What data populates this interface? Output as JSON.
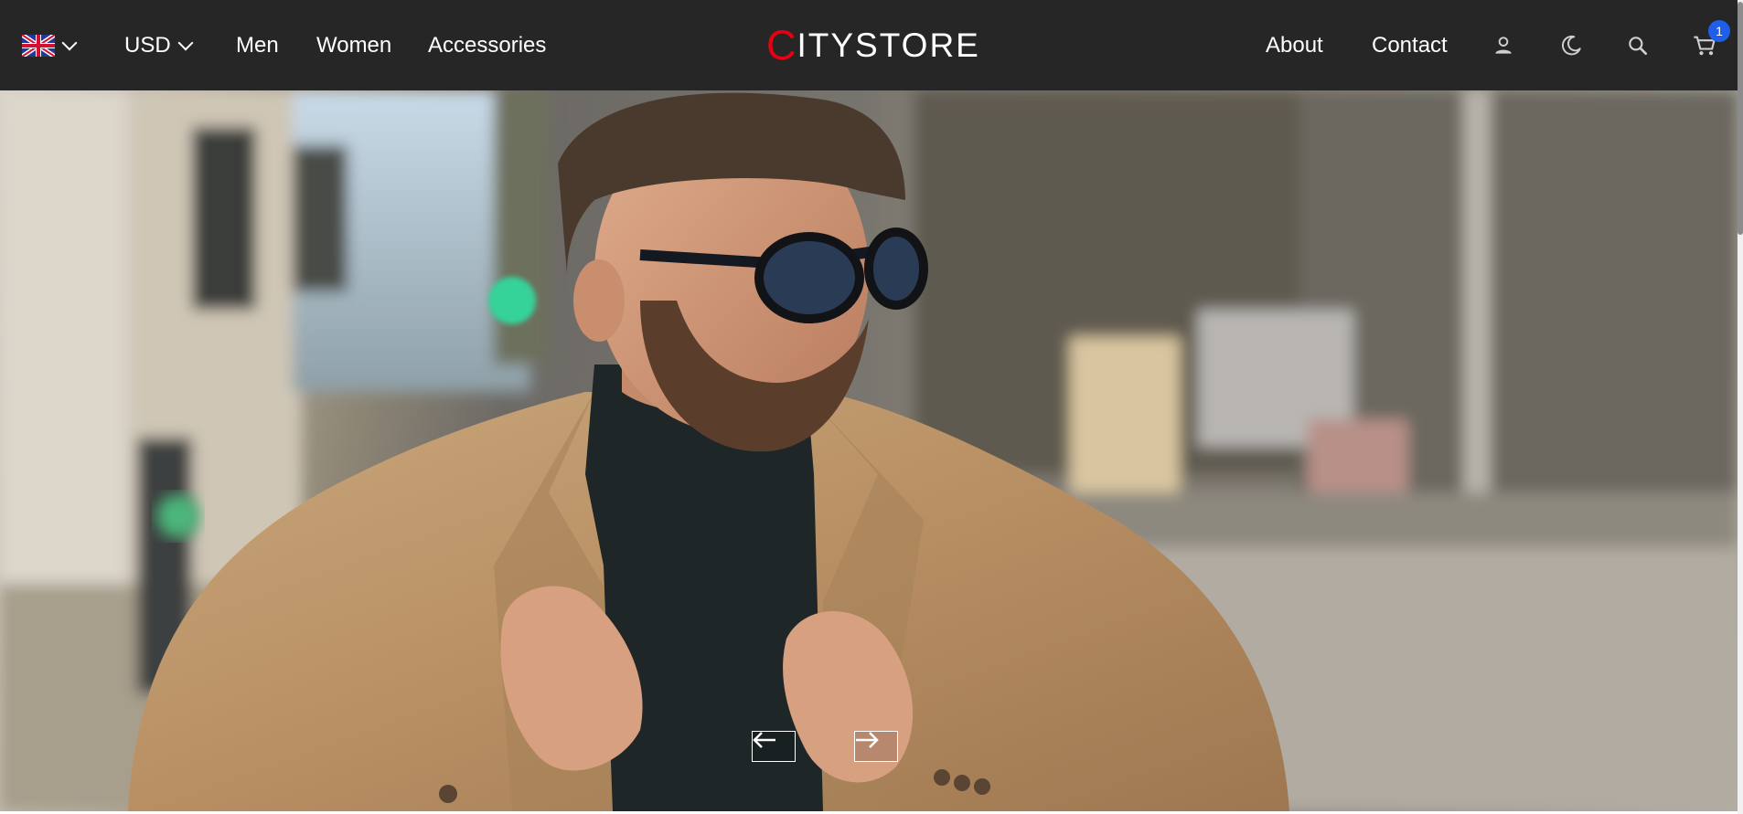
{
  "navbar": {
    "language_icon": "uk-flag-icon",
    "currency": "USD",
    "links_left": [
      "Men",
      "Women",
      "Accessories"
    ],
    "logo_first_letter": "C",
    "logo_rest": "ITYSTORE",
    "links_right": [
      "About",
      "Contact"
    ],
    "icons": [
      "user-icon",
      "moon-icon",
      "search-icon",
      "cart-icon"
    ],
    "cart_count": "1"
  },
  "hero": {
    "image_icon": "hero-photo-man-in-coat",
    "prev_icon": "arrow-left-icon",
    "next_icon": "arrow-right-icon"
  },
  "colors": {
    "navbar_bg": "#262626",
    "logo_accent": "#e60012",
    "badge": "#1e5ee8"
  }
}
